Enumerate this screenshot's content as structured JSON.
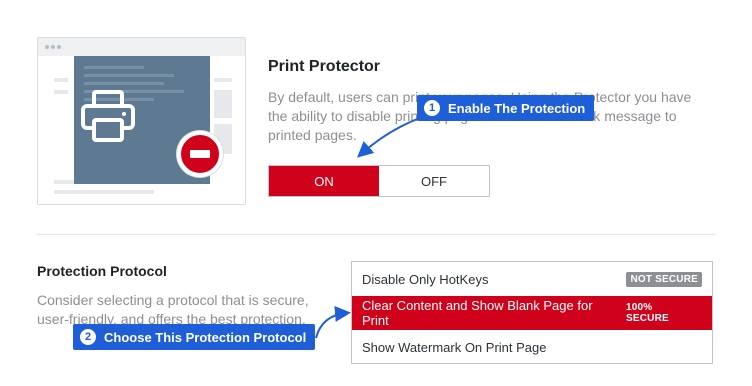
{
  "print_protector": {
    "title": "Print Protector",
    "description": "By default, users can print your pages. Using the Protector you have the ability to disable printing page or add a watermark message to printed pages.",
    "toggle": {
      "on_label": "ON",
      "off_label": "OFF",
      "selected": "ON"
    }
  },
  "protocol": {
    "title": "Protection Protocol",
    "description": "Consider selecting a protocol that is secure, user-friendly, and offers the best protection.",
    "options": [
      {
        "label": "Disable Only HotKeys",
        "tag": "NOT SECURE",
        "selected": false
      },
      {
        "label": "Clear Content and Show Blank Page for Print",
        "tag": "100% SECURE",
        "selected": true
      },
      {
        "label": "Show Watermark On Print Page",
        "tag": "",
        "selected": false
      }
    ]
  },
  "callouts": [
    {
      "number": "1",
      "label": "Enable The Protection"
    },
    {
      "number": "2",
      "label": "Choose This Protection Protocol"
    }
  ],
  "icons": {
    "illustration": "printer-icon",
    "blocked": "no-entry-icon",
    "arrow": "arrow-icon"
  },
  "colors": {
    "accent_red": "#d0021b",
    "callout_blue": "#1e5ed8",
    "illustration_slate": "#5e7a93"
  }
}
